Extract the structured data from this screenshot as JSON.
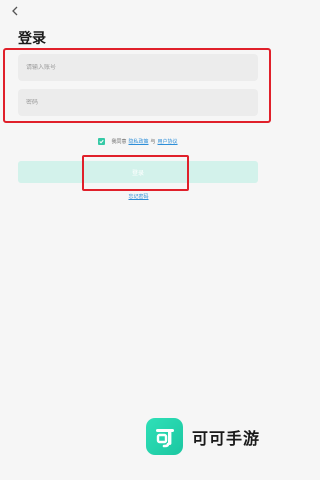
{
  "header": {
    "back_icon": "chevron-left-icon",
    "title": "登录"
  },
  "form": {
    "account_placeholder": "请输入账号",
    "password_placeholder": "密码"
  },
  "agreement": {
    "checked": true,
    "prefix": "我同意",
    "privacy_link": "隐私政策",
    "joiner": "与",
    "terms_link": "用户协议"
  },
  "login_button_label": "登录",
  "forgot_password_link": "忘记密码",
  "watermark": {
    "logo_glyph": "可",
    "text": "可可手游"
  },
  "colors": {
    "accent": "#35c9a6",
    "link": "#2d8ed8",
    "highlight": "#e0202a"
  }
}
